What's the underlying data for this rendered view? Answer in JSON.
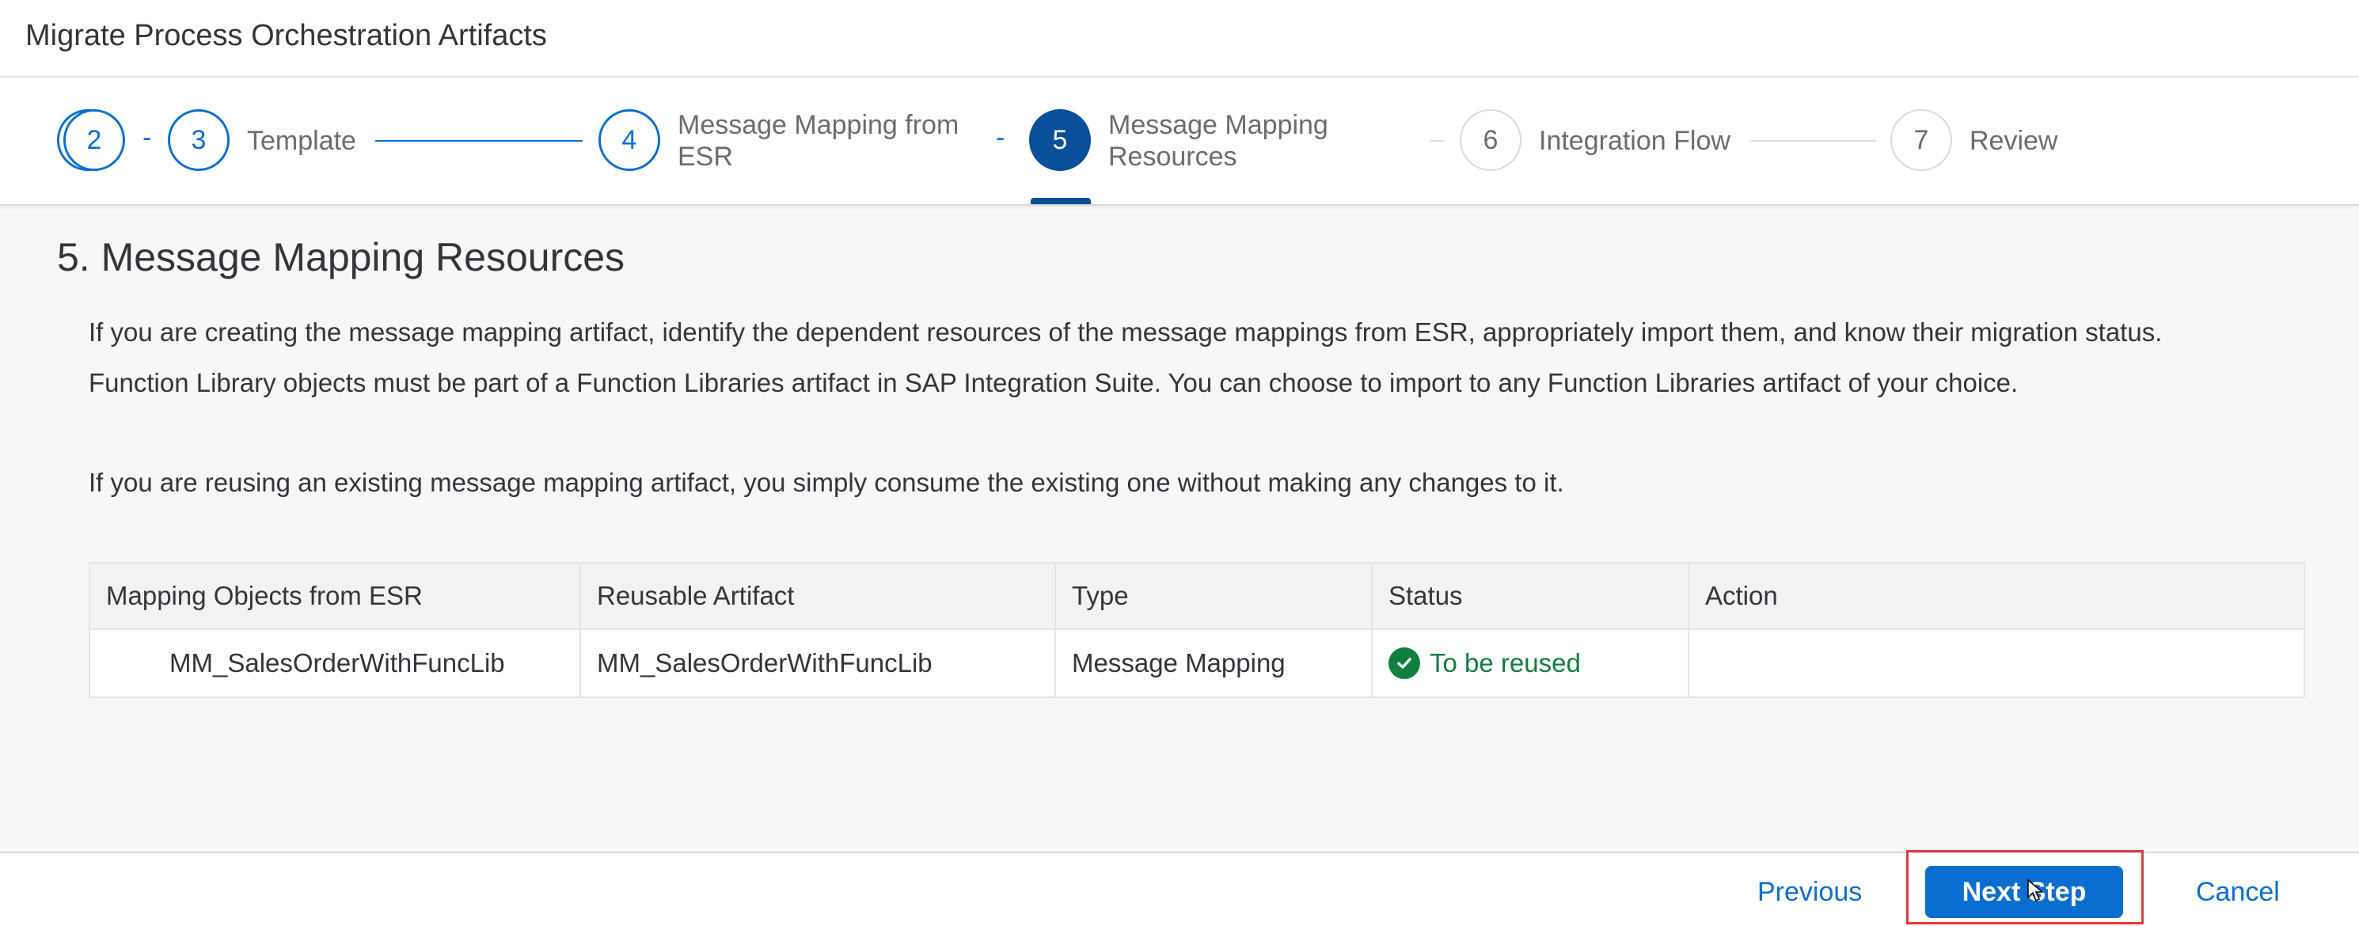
{
  "header": {
    "title": "Migrate Process Orchestration Artifacts"
  },
  "wizard": {
    "steps": [
      {
        "number": "2",
        "label": ""
      },
      {
        "number": "3",
        "label": "Template"
      },
      {
        "number": "4",
        "label_line1": "Message Mapping from",
        "label_line2": "ESR"
      },
      {
        "number": "5",
        "label_line1": "Message Mapping",
        "label_line2": "Resources"
      },
      {
        "number": "6",
        "label": "Integration Flow"
      },
      {
        "number": "7",
        "label": "Review"
      }
    ],
    "separator": "-"
  },
  "main": {
    "section_title": "5. Message Mapping Resources",
    "paragraph1_line1": "If you are creating the message mapping artifact, identify the dependent resources of the message mappings from ESR, appropriately import them, and know their migration status.",
    "paragraph1_line2": "Function Library objects must be part of a Function Libraries artifact in SAP Integration Suite. You can choose to import to any Function Libraries artifact of your choice.",
    "paragraph2": "If you are reusing an existing message mapping artifact, you simply consume the existing one without making any changes to it.",
    "table": {
      "columns": [
        "Mapping Objects from ESR",
        "Reusable Artifact",
        "Type",
        "Status",
        "Action"
      ],
      "rows": [
        {
          "mapping_object": "MM_SalesOrderWithFuncLib",
          "reusable_artifact": "MM_SalesOrderWithFuncLib",
          "type": "Message Mapping",
          "status": "To be reused",
          "action": ""
        }
      ]
    }
  },
  "footer": {
    "previous_label": "Previous",
    "next_label": "Next Step",
    "cancel_label": "Cancel"
  },
  "colors": {
    "accent": "#0a6ed1",
    "active_step": "#0a4f99",
    "success": "#107e3e",
    "highlight": "#e03c3c"
  },
  "icons": {
    "status": "check-circle-icon",
    "cursor": "mouse-pointer-icon"
  }
}
